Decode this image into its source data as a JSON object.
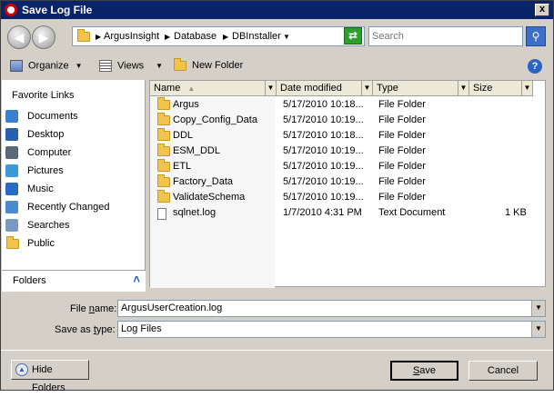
{
  "window": {
    "title": "Save Log File",
    "close_glyph": "x"
  },
  "address": {
    "breadcrumbs": [
      "ArgusInsight",
      "Database",
      "DBInstaller"
    ],
    "search_placeholder": "Search"
  },
  "toolbar": {
    "organize": "Organize",
    "views": "Views",
    "new_folder": "New Folder",
    "help": "?"
  },
  "favorites": {
    "header": "Favorite Links",
    "items": [
      {
        "label": "Documents",
        "icon": "documents-icon",
        "color": "#3a7fd1"
      },
      {
        "label": "Desktop",
        "icon": "desktop-icon",
        "color": "#2a5fb0"
      },
      {
        "label": "Computer",
        "icon": "computer-icon",
        "color": "#5a6a7a"
      },
      {
        "label": "Pictures",
        "icon": "pictures-icon",
        "color": "#3a9ad9"
      },
      {
        "label": "Music",
        "icon": "music-icon",
        "color": "#2a6ac4"
      },
      {
        "label": "Recently Changed",
        "icon": "recent-icon",
        "color": "#4a8ad0"
      },
      {
        "label": "Searches",
        "icon": "searches-icon",
        "color": "#7a9ac4"
      },
      {
        "label": "Public",
        "icon": "public-folder-icon",
        "color": "#f2c44e"
      }
    ],
    "folders_label": "Folders"
  },
  "list": {
    "columns": [
      "Name",
      "Date modified",
      "Type",
      "Size"
    ],
    "rows": [
      {
        "name": "Argus",
        "date": "5/17/2010 10:18...",
        "type": "File Folder",
        "size": ""
      },
      {
        "name": "Copy_Config_Data",
        "date": "5/17/2010 10:19...",
        "type": "File Folder",
        "size": ""
      },
      {
        "name": "DDL",
        "date": "5/17/2010 10:18...",
        "type": "File Folder",
        "size": ""
      },
      {
        "name": "ESM_DDL",
        "date": "5/17/2010 10:19...",
        "type": "File Folder",
        "size": ""
      },
      {
        "name": "ETL",
        "date": "5/17/2010 10:19...",
        "type": "File Folder",
        "size": ""
      },
      {
        "name": "Factory_Data",
        "date": "5/17/2010 10:19...",
        "type": "File Folder",
        "size": ""
      },
      {
        "name": "ValidateSchema",
        "date": "5/17/2010 10:19...",
        "type": "File Folder",
        "size": ""
      },
      {
        "name": "sqlnet.log",
        "date": "1/7/2010 4:31 PM",
        "type": "Text Document",
        "size": "1 KB"
      }
    ]
  },
  "form": {
    "file_name_label_pre": "File ",
    "file_name_label_u": "n",
    "file_name_label_post": "ame:",
    "file_name_value": "ArgusUserCreation.log",
    "save_type_label_pre": "Save as ",
    "save_type_label_u": "t",
    "save_type_label_post": "ype:",
    "save_type_value": "Log Files"
  },
  "buttons": {
    "hide_folders": "Hide Folders",
    "save_u": "S",
    "save_rest": "ave",
    "cancel": "Cancel"
  }
}
